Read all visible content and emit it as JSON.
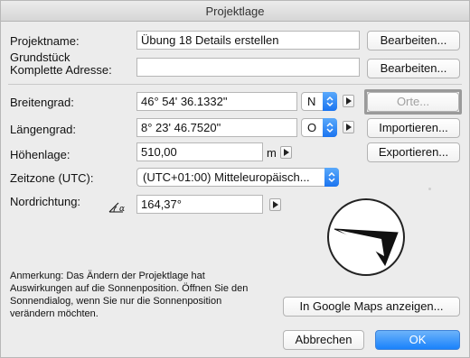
{
  "window": {
    "title": "Projektlage"
  },
  "fields": {
    "projektname": {
      "label": "Projektname:",
      "value": "Übung 18 Details erstellen",
      "button": "Bearbeiten..."
    },
    "adresse": {
      "label_line1": "Grundstück",
      "label_line2": "Komplette Adresse:",
      "value": "",
      "button": "Bearbeiten..."
    },
    "breitengrad": {
      "label": "Breitengrad:",
      "value": "46° 54' 36.1332\"",
      "direction": "N"
    },
    "laengengrad": {
      "label": "Längengrad:",
      "value": "8° 23' 46.7520\"",
      "direction": "O"
    },
    "hoehenlage": {
      "label": "Höhenlage:",
      "value": "510,00",
      "unit": "m"
    },
    "zeitzone": {
      "label": "Zeitzone (UTC):",
      "value": "(UTC+01:00) Mitteleuropäisch..."
    },
    "nordrichtung": {
      "label": "Nordrichtung:",
      "value": "164,37°"
    }
  },
  "side_buttons": {
    "orte": "Orte...",
    "importieren": "Importieren...",
    "exportieren": "Exportieren..."
  },
  "note": "Anmerkung: Das Ändern der Projektlage hat Auswirkungen auf die Sonnenposition. Öffnen Sie den Sonnendialog, wenn Sie nur die Sonnenposition verändern möchten.",
  "buttons": {
    "google_maps": "In Google Maps anzeigen...",
    "cancel": "Abbrechen",
    "ok": "OK"
  },
  "icons": {
    "compass": "north-direction-compass-icon",
    "angle": "angle-icon"
  },
  "colors": {
    "accent": "#1a82fb",
    "stepper": "#1a74f0"
  }
}
